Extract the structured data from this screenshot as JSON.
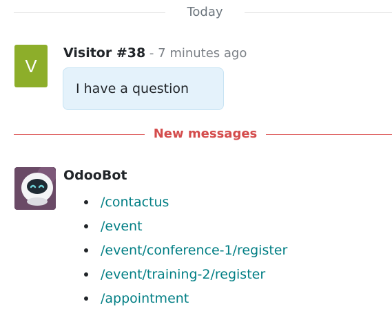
{
  "divider_today": {
    "label": "Today"
  },
  "visitor_message": {
    "avatar_letter": "V",
    "author": "Visitor #38",
    "separator": " - ",
    "time": "7 minutes ago",
    "body": "I have a question"
  },
  "divider_new": {
    "label": "New messages"
  },
  "bot_message": {
    "author": "OdooBot",
    "links": [
      {
        "label": "/contactus"
      },
      {
        "label": "/event"
      },
      {
        "label": "/event/conference-1/register"
      },
      {
        "label": "/event/training-2/register"
      },
      {
        "label": "/appointment"
      }
    ]
  },
  "colors": {
    "visitor_avatar": "#8dae2a",
    "bubble_bg": "#e4f2fb",
    "new_messages": "#d44c4c",
    "link": "#017e84",
    "bot_avatar_bg": "#6a4a66"
  },
  "icons": {
    "bot_avatar": "odoobot-robot-icon"
  }
}
